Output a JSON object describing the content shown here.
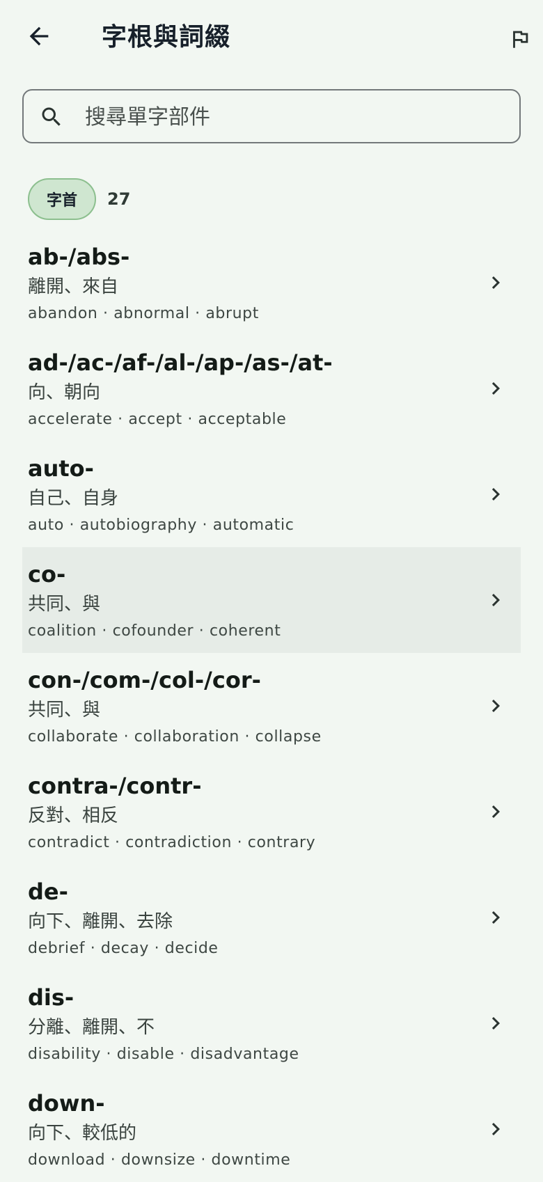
{
  "header": {
    "title": "字根與詞綴",
    "back_icon": "arrow-left-icon",
    "flag_icon": "flag-icon"
  },
  "search": {
    "placeholder": "搜尋單字部件",
    "value": "",
    "icon": "search-icon"
  },
  "filter": {
    "chip_label": "字首",
    "count": "27",
    "chip_color": "#CFE6D0"
  },
  "items": [
    {
      "name": "ab-/abs-",
      "meaning": "離開、來自",
      "examples": "abandon · abnormal · abrupt"
    },
    {
      "name": "ad-/ac-/af-/al-/ap-/as-/at-",
      "meaning": "向、朝向",
      "examples": "accelerate · accept · acceptable"
    },
    {
      "name": "auto-",
      "meaning": "自己、自身",
      "examples": "auto · autobiography · automatic"
    },
    {
      "name": "co-",
      "meaning": "共同、與",
      "examples": "coalition · cofounder · coherent"
    },
    {
      "name": "con-/com-/col-/cor-",
      "meaning": "共同、與",
      "examples": "collaborate · collaboration · collapse"
    },
    {
      "name": "contra-/contr-",
      "meaning": "反對、相反",
      "examples": "contradict · contradiction · contrary"
    },
    {
      "name": "de-",
      "meaning": "向下、離開、去除",
      "examples": "debrief · decay · decide"
    },
    {
      "name": "dis-",
      "meaning": "分離、離開、不",
      "examples": "disability · disable · disadvantage"
    },
    {
      "name": "down-",
      "meaning": "向下、較低的",
      "examples": "download · downsize · downtime"
    }
  ],
  "colors": {
    "background": "#F2F7F2",
    "highlight_row": "#E6ECE7",
    "chip_border": "#8CBF8E"
  }
}
